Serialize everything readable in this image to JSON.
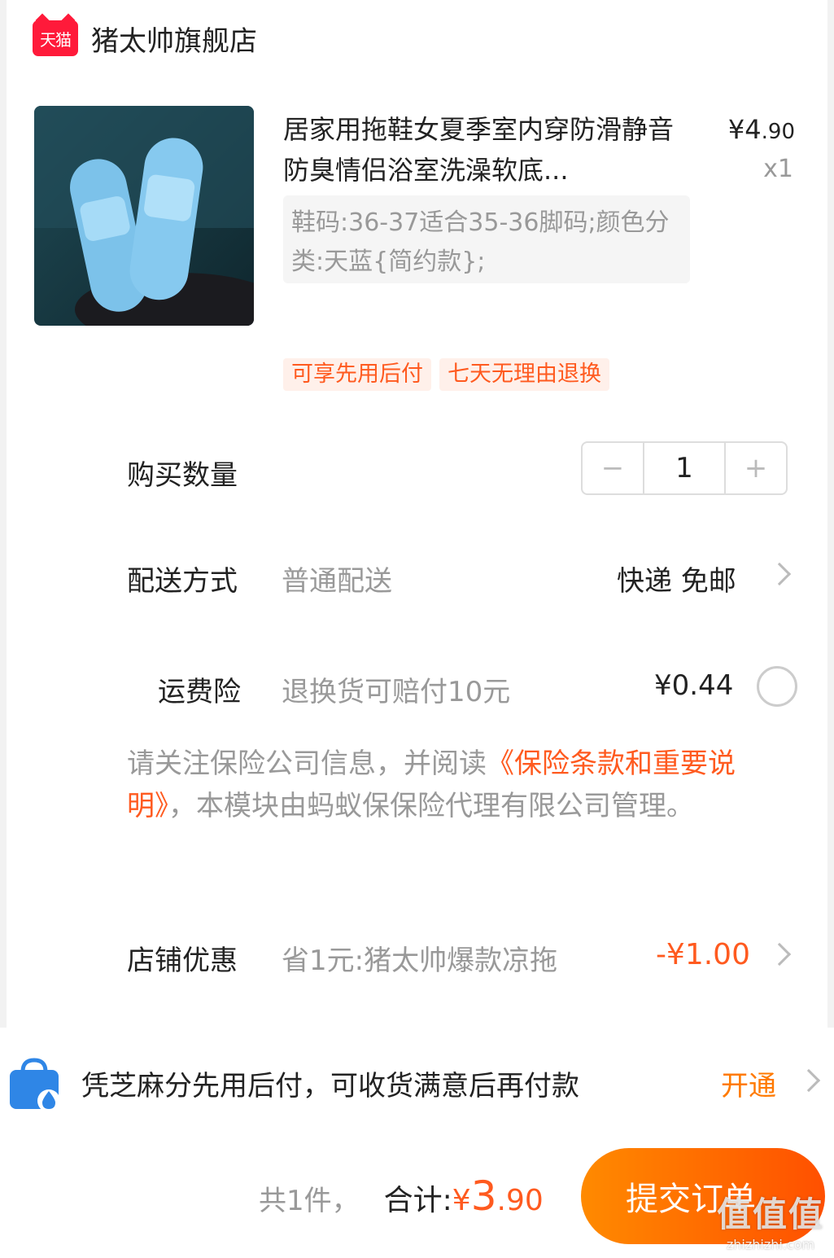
{
  "store": {
    "badge": "天猫",
    "name": "猪太帅旗舰店"
  },
  "product": {
    "title": "居家用拖鞋女夏季室内穿防滑静音防臭情侣浴室洗澡软底...",
    "price_symbol": "¥",
    "price_int": "4",
    "price_dec": ".90",
    "quantity_label": "x1",
    "sku": "鞋码:36-37适合35-36脚码;颜色分类:天蓝{简约款};",
    "tags": [
      "可享先用后付",
      "七天无理由退换"
    ]
  },
  "quantity": {
    "label": "购买数量",
    "minus": "−",
    "value": "1",
    "plus": "+"
  },
  "delivery": {
    "label": "配送方式",
    "method": "普通配送",
    "value": "快递 免邮"
  },
  "insurance": {
    "label": "运费险",
    "desc": "退换货可赔付10元",
    "price": "¥0.44",
    "notice_pre": "请关注保险公司信息，并阅读",
    "notice_link": "《保险条款和重要说明》",
    "notice_post": "，本模块由蚂蚁保保险代理有限公司管理。"
  },
  "coupon": {
    "label": "店铺优惠",
    "desc": "省1元:猪太帅爆款凉拖",
    "value": "-¥1.00"
  },
  "credit": {
    "text": "凭芝麻分先用后付，可收货满意后再付款",
    "action": "开通"
  },
  "footer": {
    "count": "共1件，",
    "total_label": "合计:",
    "total_currency": "¥",
    "total_int": "3",
    "total_dec": ".90",
    "submit": "提交订单"
  },
  "watermark": {
    "main": "值值值",
    "sub": "zhizhizhi.com"
  },
  "colors": {
    "accent": "#ff5a1f",
    "tmall": "#ff1a3a",
    "button_start": "#ff8a00",
    "button_end": "#ff5000"
  }
}
